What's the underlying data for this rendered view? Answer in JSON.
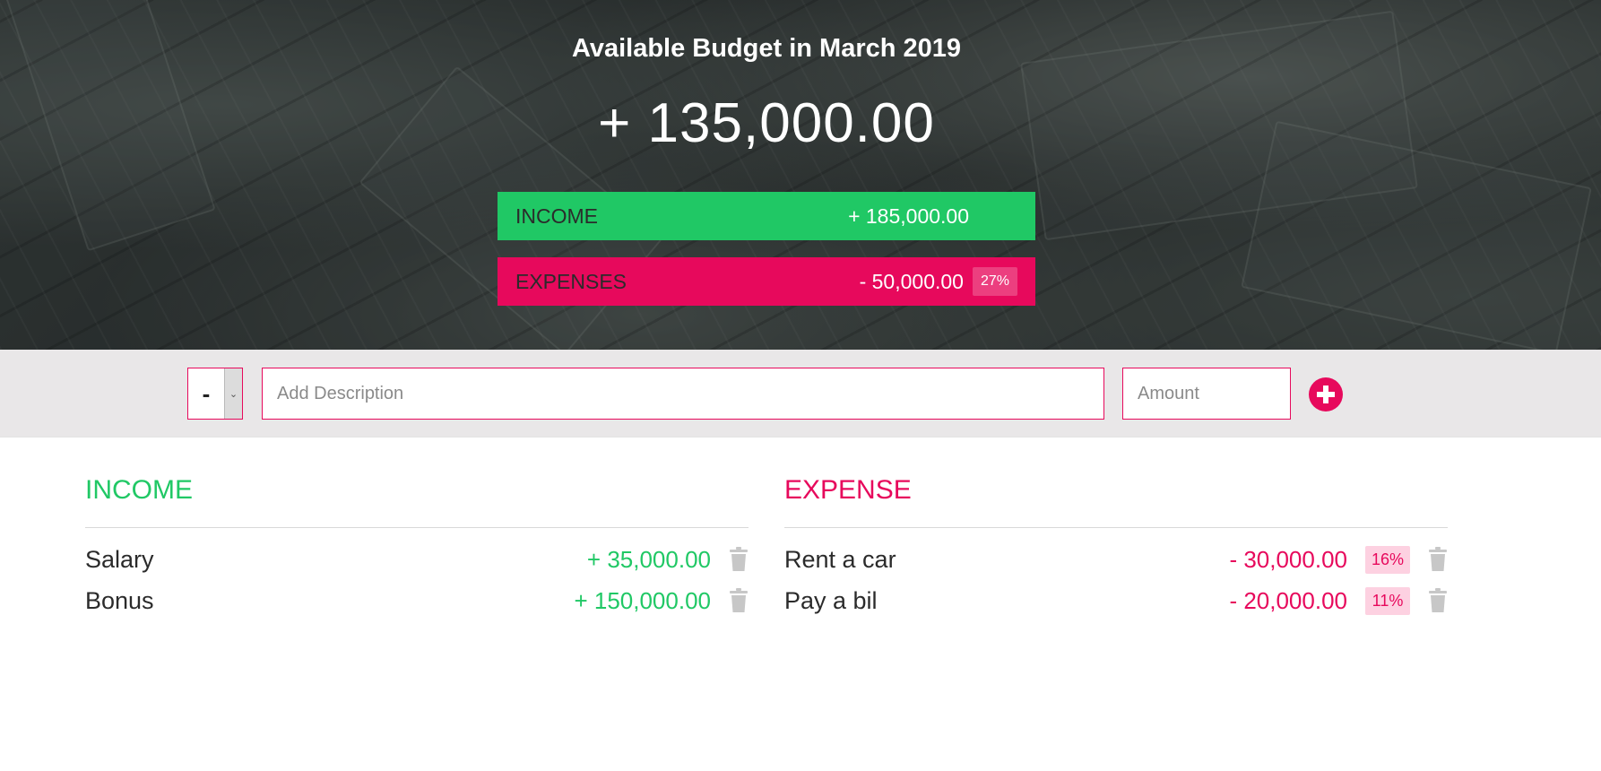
{
  "header": {
    "title": "Available Budget in March 2019",
    "budget": "+ 135,000.00",
    "income": {
      "label": "INCOME",
      "value": "+ 185,000.00"
    },
    "expenses": {
      "label": "EXPENSES",
      "value": "- 50,000.00",
      "percentage": "27%"
    }
  },
  "add_bar": {
    "type_selected": "-",
    "description_placeholder": "Add Description",
    "amount_placeholder": "Amount",
    "add_icon": "plus-circle-icon"
  },
  "income_list": {
    "title": "INCOME",
    "items": [
      {
        "description": "Salary",
        "value": "+ 35,000.00"
      },
      {
        "description": "Bonus",
        "value": "+ 150,000.00"
      }
    ]
  },
  "expense_list": {
    "title": "EXPENSE",
    "items": [
      {
        "description": "Rent a car",
        "value": "- 30,000.00",
        "percentage": "16%"
      },
      {
        "description": "Pay a bil",
        "value": "- 20,000.00",
        "percentage": "11%"
      }
    ]
  },
  "icons": {
    "delete": "trash-icon"
  },
  "colors": {
    "income": "#20c865",
    "expense": "#e7095c",
    "expense_pct_bg": "#fdd1e1",
    "add_bar_bg": "#e9e7e8",
    "trash": "#c7c7c7"
  }
}
